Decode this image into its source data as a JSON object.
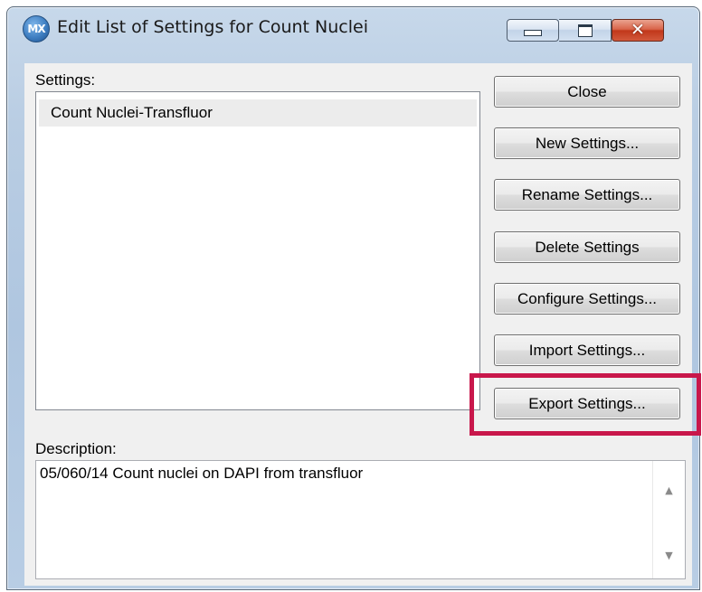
{
  "window": {
    "title": "Edit List of Settings for Count Nuclei",
    "app_icon_text": "MX",
    "controls": {
      "minimize": "minimize-icon",
      "maximize": "maximize-icon",
      "close": "close-icon"
    },
    "close_glyph": "✕"
  },
  "settings": {
    "label": "Settings:",
    "items": [
      "Count Nuclei-Transfluor"
    ]
  },
  "buttons": {
    "close": "Close",
    "new": "New Settings...",
    "rename": "Rename Settings...",
    "delete": "Delete Settings",
    "configure": "Configure Settings...",
    "import": "Import Settings...",
    "export": "Export Settings..."
  },
  "highlight": {
    "target": "export-settings-button",
    "color": "#c8174b"
  },
  "description": {
    "label": "Description:",
    "text": "05/060/14 Count nuclei on DAPI from transfluor",
    "scroll_up": "▲",
    "scroll_down": "▼"
  }
}
